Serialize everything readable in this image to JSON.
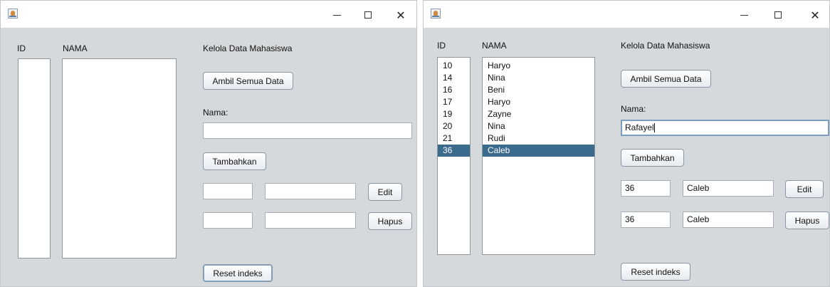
{
  "labels": {
    "id_header": "ID",
    "nama_header": "NAMA",
    "title": "Kelola Data Mahasiswa",
    "nama_label": "Nama:"
  },
  "buttons": {
    "ambil": "Ambil Semua Data",
    "tambah": "Tambahkan",
    "edit": "Edit",
    "hapus": "Hapus",
    "reset": "Reset indeks"
  },
  "icons": {
    "app": "java-app-icon",
    "minimize": "minimize-icon",
    "maximize": "maximize-icon",
    "close": "close-icon"
  },
  "window_controls": {
    "close_glyph": "✕"
  },
  "colors": {
    "selection": "#3a6a8c",
    "focus_border": "#7b9dc0"
  },
  "left_window": {
    "ids": [],
    "names": [],
    "nama_input": "",
    "edit_id": "",
    "edit_nama": "",
    "hapus_id": "",
    "hapus_nama": ""
  },
  "right_window": {
    "ids": [
      "10",
      "14",
      "16",
      "17",
      "19",
      "20",
      "21",
      "36"
    ],
    "names": [
      "Haryo",
      "Nina",
      "Beni",
      "Haryo",
      "Zayne",
      "Nina",
      "Rudi",
      "Caleb"
    ],
    "selected_index": 7,
    "nama_input": "Rafayel",
    "edit_id": "36",
    "edit_nama": "Caleb",
    "hapus_id": "36",
    "hapus_nama": "Caleb"
  }
}
